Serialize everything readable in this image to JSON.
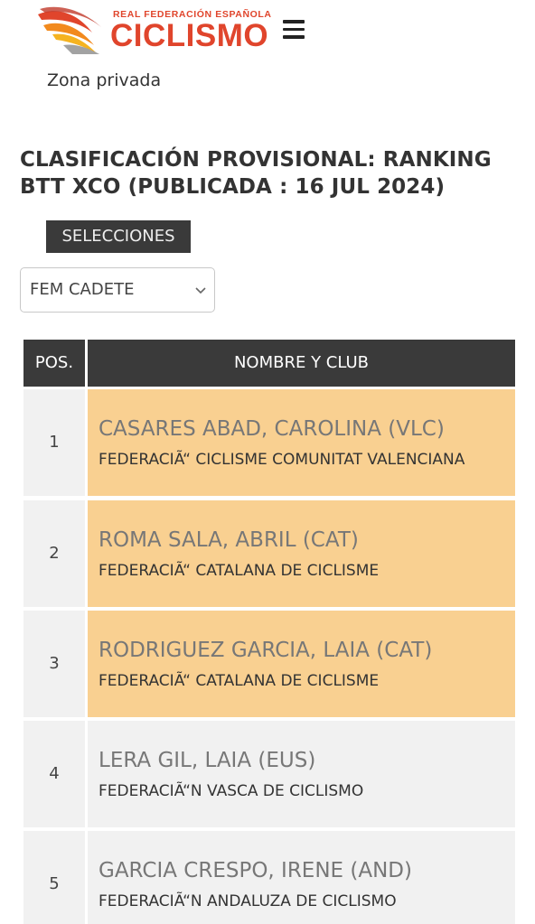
{
  "header": {
    "logo_top": "REAL FEDERACIÓN ESPAÑOLA",
    "logo_main": "CICLISMO",
    "logo_icon": "cycling-swirl-logo",
    "menu_icon": "hamburger-menu-icon",
    "zona_privada": "Zona privada"
  },
  "page": {
    "title": "CLASIFICACIÓN PROVISIONAL: RANKING BTT XCO (PUBLICADA : 16 JUL 2024)"
  },
  "controls": {
    "selecciones_label": "SELECCIONES",
    "category_value": "FEM CADETE",
    "category_icon": "chevron-down-icon"
  },
  "table": {
    "headers": {
      "pos": "POS.",
      "name": "NOMBRE Y CLUB"
    },
    "rows": [
      {
        "pos": "1",
        "rider": "CASARES ABAD, CAROLINA (VLC)",
        "club": "FEDERACIÃ“ CICLISME COMUNITAT VALENCIANA"
      },
      {
        "pos": "2",
        "rider": "ROMA SALA, ABRIL (CAT)",
        "club": "FEDERACIÃ“ CATALANA DE CICLISME"
      },
      {
        "pos": "3",
        "rider": "RODRIGUEZ GARCIA, LAIA (CAT)",
        "club": "FEDERACIÃ“ CATALANA DE CICLISME"
      },
      {
        "pos": "4",
        "rider": "LERA GIL, LAIA (EUS)",
        "club": "FEDERACIÃ“N VASCA DE CICLISMO"
      },
      {
        "pos": "5",
        "rider": "GARCIA CRESPO, IRENE (AND)",
        "club": "FEDERACIÃ“N ANDALUZA DE CICLISMO"
      }
    ]
  },
  "colors": {
    "brand": "#e0452c",
    "header_bg": "#3a3a3a",
    "podium_bg": "#f9d091",
    "row_bg": "#f1f1f1"
  }
}
